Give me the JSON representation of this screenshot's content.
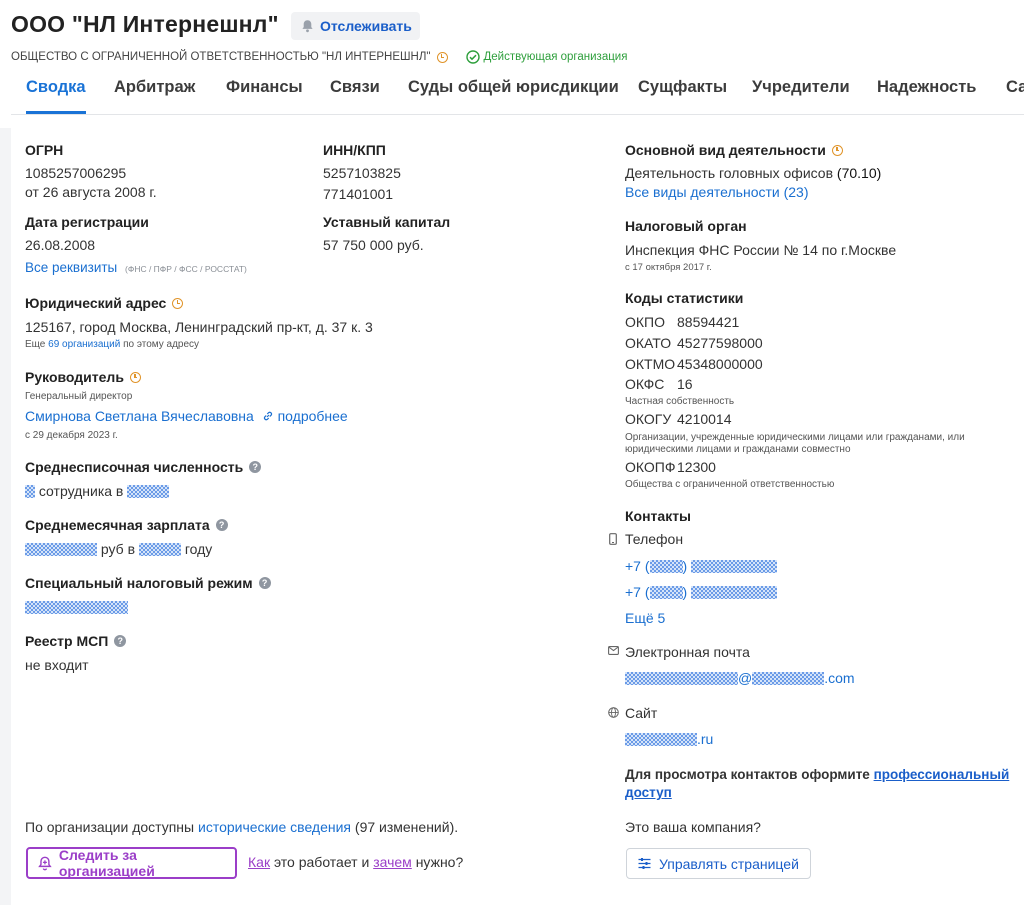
{
  "header": {
    "title": "ООО \"НЛ Интернешнл\"",
    "track_label": "Отслеживать",
    "full_name": "ОБЩЕСТВО С ОГРАНИЧЕННОЙ ОТВЕТСТВЕННОСТЬЮ \"НЛ ИНТЕРНЕШНЛ\"",
    "status": "Действующая организация"
  },
  "tabs": [
    "Сводка",
    "Арбитраж",
    "Финансы",
    "Связи",
    "Суды общей юрисдикции",
    "Сущфакты",
    "Учредители",
    "Надежность",
    "Са"
  ],
  "left": {
    "ogrn_label": "ОГРН",
    "ogrn_value": "1085257006295",
    "ogrn_date": "от 26 августа 2008 г.",
    "inn_label": "ИНН/КПП",
    "inn_value": "5257103825",
    "kpp_value": "771401001",
    "reg_label": "Дата регистрации",
    "reg_value": "26.08.2008",
    "capital_label": "Уставный капитал",
    "capital_value": "57 750 000 руб.",
    "all_requisites": "Все реквизиты",
    "requisites_note": "(ФНС / ПФР / ФСС / РОССТАТ)",
    "address_label": "Юридический адрес",
    "address_value": "125167, город Москва, Ленинградский пр-кт, д. 37 к. 3",
    "address_note_pre": "Еще",
    "address_note_link": "69 организаций",
    "address_note_post": "по этому адресу",
    "head_label": "Руководитель",
    "head_role": "Генеральный директор",
    "head_name": "Смирнова Светлана Вячеславовна",
    "head_more": "подробнее",
    "head_since": "с 29 декабря 2023 г.",
    "staff_label": "Среднесписочная численность",
    "staff_text_mid": "сотрудника в",
    "salary_label": "Среднемесячная зарплата",
    "salary_text_mid": "руб в",
    "salary_text_end": "году",
    "tax_regime_label": "Специальный налоговый режим",
    "msp_label": "Реестр МСП",
    "msp_value": "не входит",
    "history_pre": "По организации доступны",
    "history_link": "исторические сведения",
    "history_post": "(97 изменений).",
    "follow_btn": "Следить за организацией",
    "how_link": "Как",
    "how_mid": "это работает и",
    "why_link": "зачем",
    "why_post": "нужно?"
  },
  "right": {
    "activity_label": "Основной вид деятельности",
    "activity_value": "Деятельность головных офисов",
    "activity_code": "(70.10)",
    "activity_all": "Все виды деятельности (23)",
    "tax_org_label": "Налоговый орган",
    "tax_org_value": "Инспекция ФНС России № 14 по г.Москве",
    "tax_org_since": "с 17 октября 2017 г.",
    "stat_label": "Коды статистики",
    "codes": {
      "okpo_k": "ОКПО",
      "okpo_v": "88594421",
      "okato_k": "ОКАТО",
      "okato_v": "45277598000",
      "oktmo_k": "ОКТМО",
      "oktmo_v": "45348000000",
      "okfs_k": "ОКФС",
      "okfs_v": "16",
      "okfs_note": "Частная собственность",
      "okogu_k": "ОКОГУ",
      "okogu_v": "4210014",
      "okogu_note1": "Организации, учрежденные юридическими лицами или гражданами, или",
      "okogu_note2": "юридическими лицами и гражданами совместно",
      "okopf_k": "ОКОПФ",
      "okopf_v": "12300",
      "okopf_note": "Общества с ограниченной ответственностью"
    },
    "contacts_label": "Контакты",
    "phone_label": "Телефон",
    "phone_prefix": "+7 (",
    "phone_close": ")",
    "phone_more": "Ещё 5",
    "email_label": "Электронная почта",
    "email_at": "@",
    "email_tld": ".com",
    "site_label": "Сайт",
    "site_tld": ".ru",
    "pro_text": "Для просмотра контактов оформите",
    "pro_link1": "профессиональный",
    "pro_link2": "доступ",
    "your_company": "Это ваша компания?",
    "manage_btn": "Управлять страницей"
  }
}
